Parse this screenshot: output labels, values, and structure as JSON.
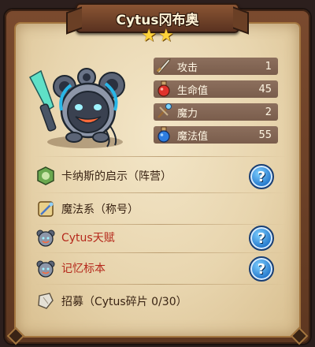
{
  "header": {
    "title": "Cytus冈布奥",
    "star_count": 2
  },
  "stats": [
    {
      "label": "攻击",
      "value": "1",
      "icon": "sword-icon"
    },
    {
      "label": "生命值",
      "value": "45",
      "icon": "red-potion-icon"
    },
    {
      "label": "魔力",
      "value": "2",
      "icon": "magic-staff-icon"
    },
    {
      "label": "魔法值",
      "value": "55",
      "icon": "blue-potion-icon"
    }
  ],
  "skills": [
    {
      "label": "卡纳斯的启示（阵营）",
      "icon": "faction-emblem-icon",
      "has_help": true,
      "highlight": false
    },
    {
      "label": "魔法系（称号）",
      "icon": "title-badge-icon",
      "has_help": false,
      "highlight": false
    },
    {
      "label": "Cytus天赋",
      "icon": "cytus-robot-icon",
      "has_help": true,
      "highlight": true
    },
    {
      "label": "记忆标本",
      "icon": "cytus-robot-icon",
      "has_help": true,
      "highlight": true
    },
    {
      "label": "招募（Cytus碎片 0/30）",
      "icon": "fragment-icon",
      "has_help": false,
      "highlight": false
    }
  ],
  "help_label": "?",
  "colors": {
    "parchment": "#e8d5ae",
    "frame": "#5e3720",
    "stat_bar": "#8c6f5d",
    "highlight_text": "#b5281b",
    "help_button": "#1f73c9"
  }
}
